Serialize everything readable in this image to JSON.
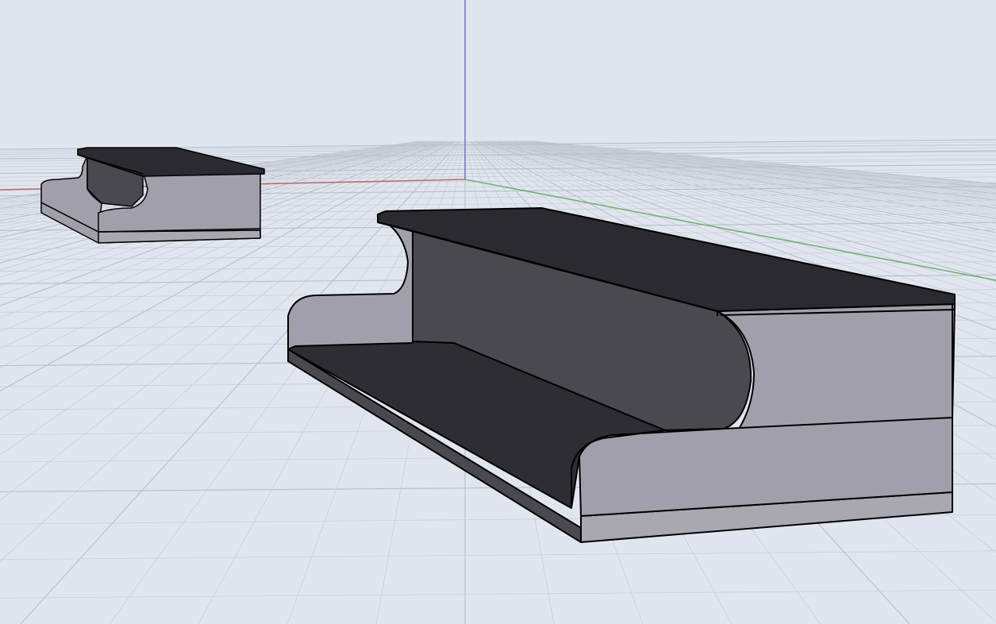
{
  "viewport": {
    "view": "perspective",
    "background_color": "#e1e6ee",
    "grid": {
      "visible": true,
      "minor_line_color": "#c7ced8",
      "major_line_color": "#b9c0ca"
    },
    "axes": {
      "x_axis_color": "#b56a6a",
      "y_axis_color": "#6fae72",
      "z_axis_color": "#6f73c4"
    },
    "objects": [
      {
        "name": "small-bracket",
        "top_face_color": "#2b2a30",
        "side_face_color": "#a1a0aa",
        "inner_face_color": "#4a4950",
        "edge_color": "#000000"
      },
      {
        "name": "large-bracket",
        "top_face_color": "#2b2a30",
        "side_face_color": "#a1a0aa",
        "inner_face_color": "#4a4950",
        "edge_color": "#000000"
      }
    ]
  }
}
